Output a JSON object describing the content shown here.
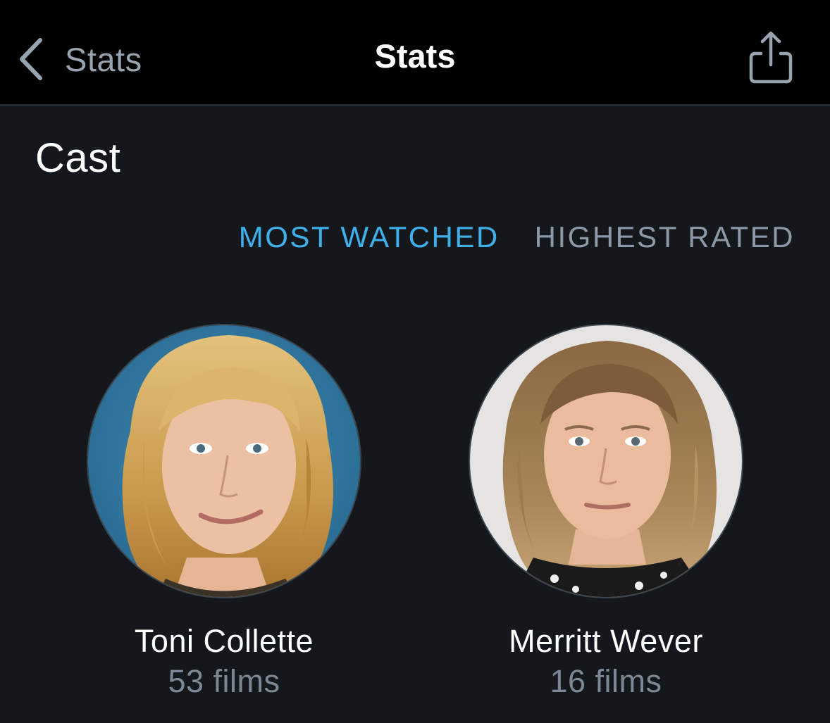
{
  "nav": {
    "back_label": "Stats",
    "title": "Stats",
    "back_icon": "chevron-left-icon",
    "share_icon": "share-icon"
  },
  "section": {
    "title": "Cast"
  },
  "tabs": [
    {
      "label": "MOST WATCHED",
      "active": true
    },
    {
      "label": "HIGHEST RATED",
      "active": false
    }
  ],
  "cast": [
    {
      "name": "Toni Collette",
      "count": "53 films"
    },
    {
      "name": "Merritt Wever",
      "count": "16 films"
    }
  ],
  "colors": {
    "background": "#14181d",
    "navbar": "#000000",
    "accent": "#40b0ea",
    "muted_text": "#8d99a7"
  }
}
